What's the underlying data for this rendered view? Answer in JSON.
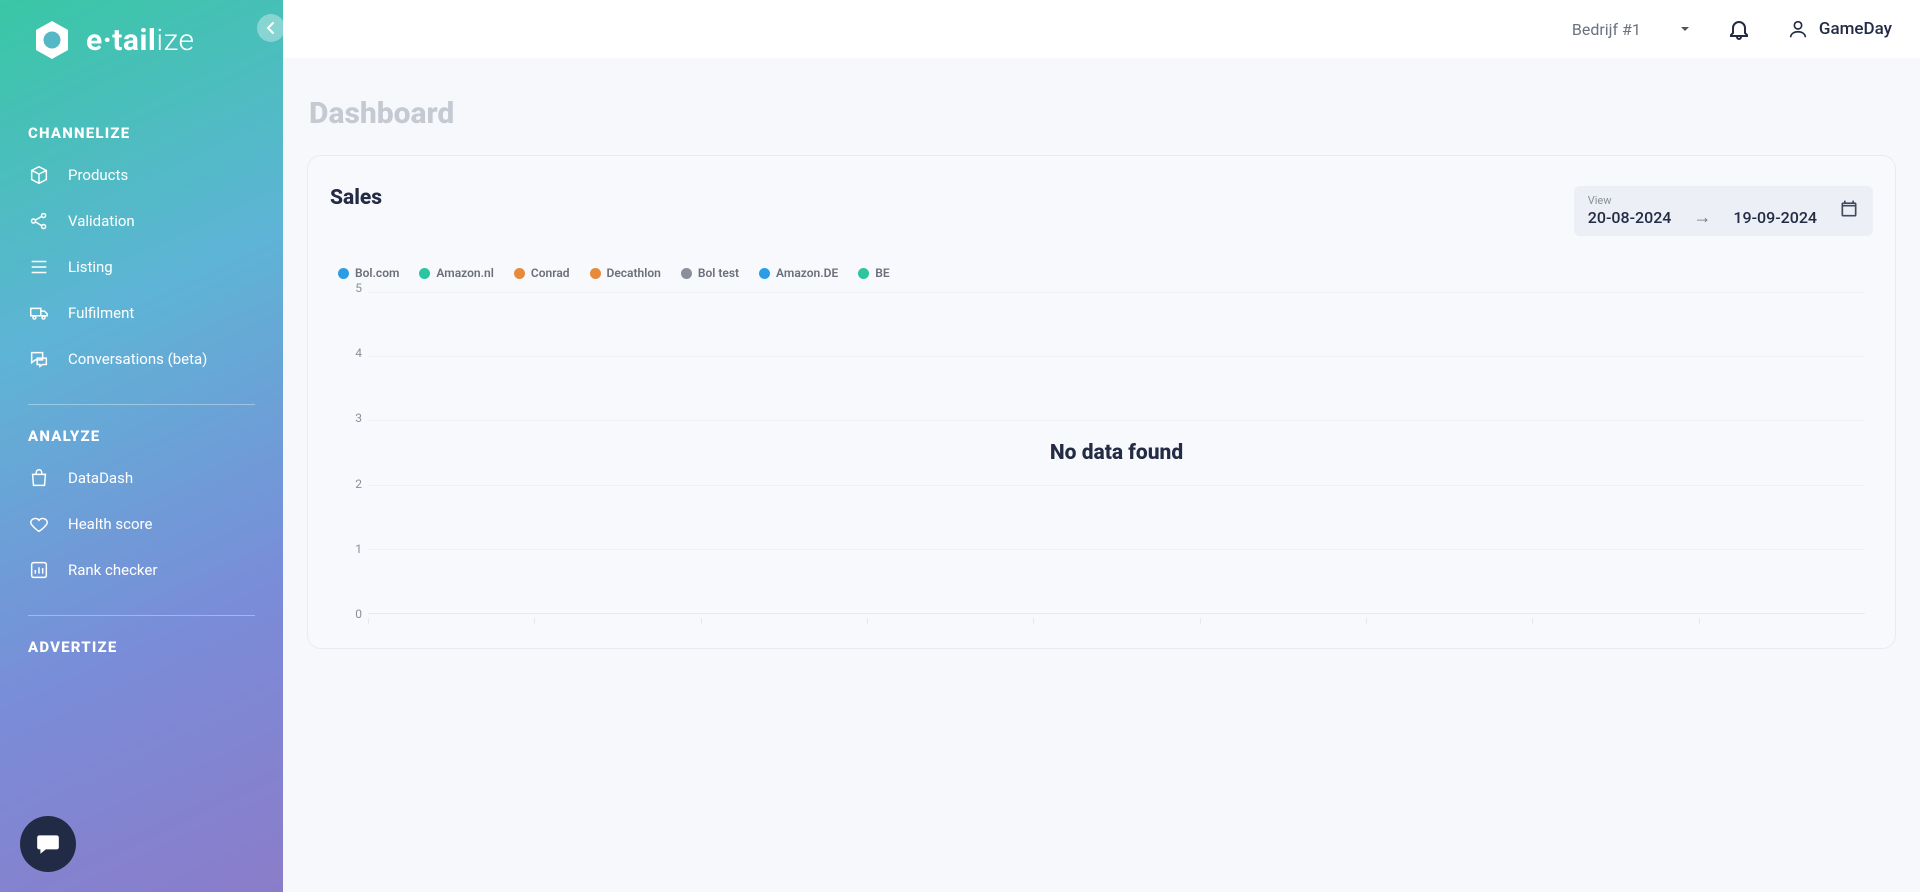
{
  "brand": {
    "name_rich_a": "e·tail",
    "name_rich_b": "ize"
  },
  "header": {
    "company": "Bedrijf #1",
    "user": "GameDay"
  },
  "page": {
    "title": "Dashboard"
  },
  "sidebar": {
    "sections": [
      {
        "title": "CHANNELIZE",
        "items": [
          {
            "label": "Products",
            "icon": "box-icon"
          },
          {
            "label": "Validation",
            "icon": "share-icon"
          },
          {
            "label": "Listing",
            "icon": "list-icon"
          },
          {
            "label": "Fulfilment",
            "icon": "truck-icon"
          },
          {
            "label": "Conversations (beta)",
            "icon": "chat-icon"
          }
        ]
      },
      {
        "title": "ANALYZE",
        "items": [
          {
            "label": "DataDash",
            "icon": "bag-icon"
          },
          {
            "label": "Health score",
            "icon": "heart-icon"
          },
          {
            "label": "Rank checker",
            "icon": "barchart-icon"
          }
        ]
      },
      {
        "title": "ADVERTIZE",
        "items": []
      }
    ]
  },
  "sales": {
    "title": "Sales",
    "view_label": "View",
    "date_from": "20-08-2024",
    "date_to": "19-09-2024",
    "no_data": "No data found"
  },
  "chart_data": {
    "type": "line",
    "title": "Sales",
    "xlabel": "",
    "ylabel": "",
    "ylim": [
      0,
      5
    ],
    "y_ticks": [
      5,
      4,
      3,
      2,
      1,
      0
    ],
    "categories": [],
    "series": [
      {
        "name": "Bol.com",
        "color": "#2b9de4",
        "values": []
      },
      {
        "name": "Amazon.nl",
        "color": "#2bc6a0",
        "values": []
      },
      {
        "name": "Conrad",
        "color": "#e98a3a",
        "values": []
      },
      {
        "name": "Decathlon",
        "color": "#e98a3a",
        "values": []
      },
      {
        "name": "Bol test",
        "color": "#8a8f9b",
        "values": []
      },
      {
        "name": "Amazon.DE",
        "color": "#2b9de4",
        "values": []
      },
      {
        "name": "BE",
        "color": "#2bc6a0",
        "values": []
      }
    ],
    "empty_message": "No data found"
  }
}
